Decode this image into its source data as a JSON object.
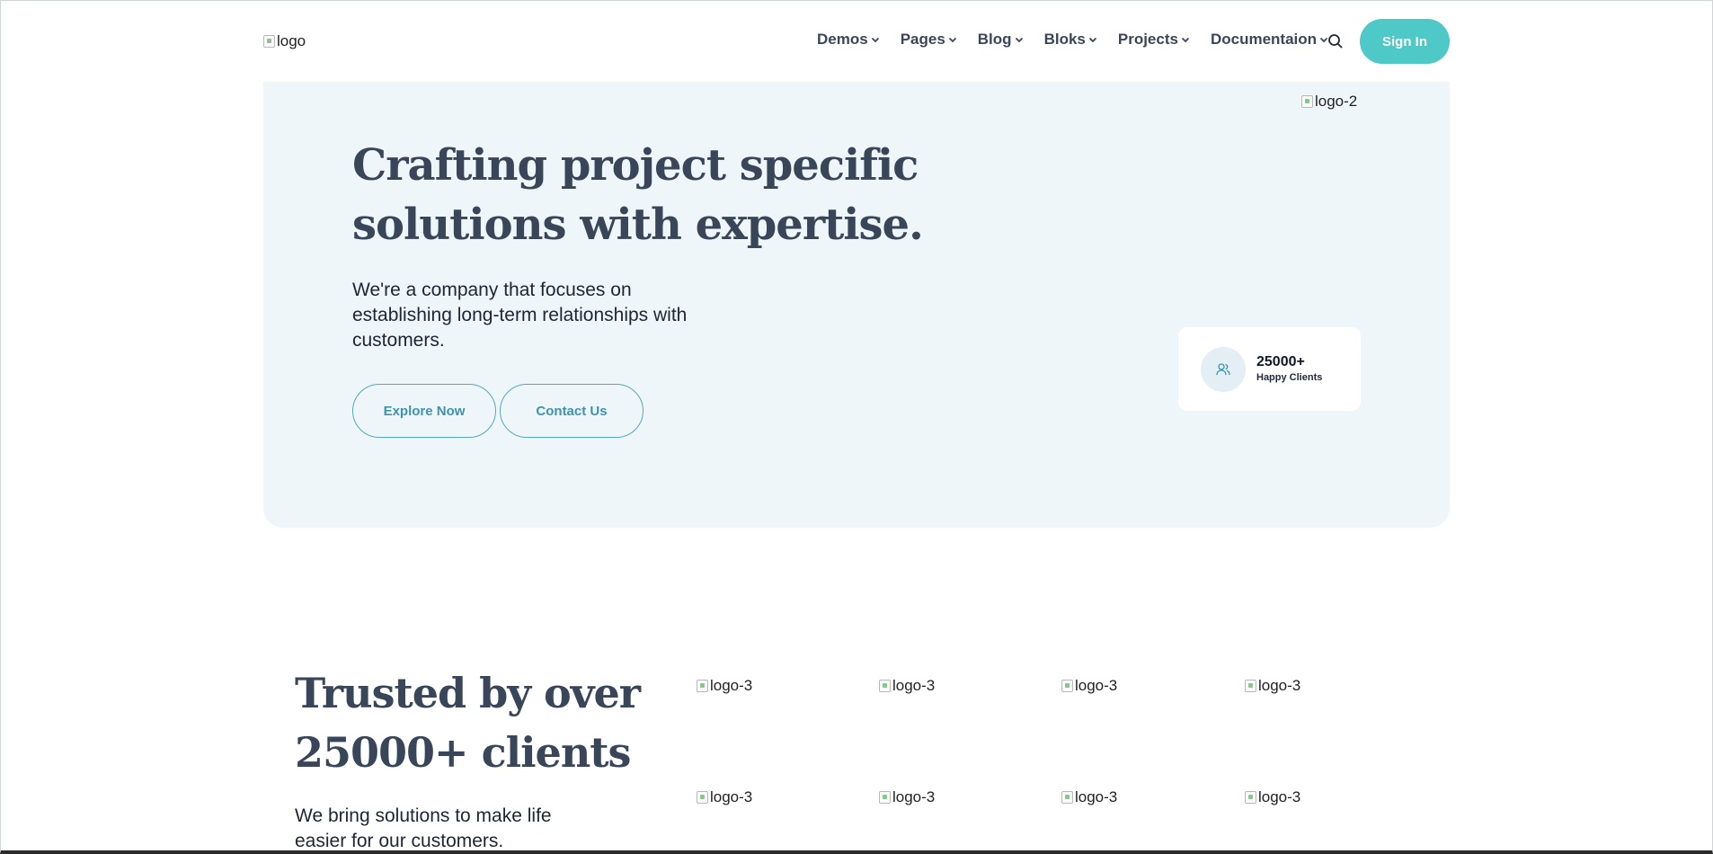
{
  "header": {
    "logo_alt": "logo",
    "nav": [
      {
        "label": "Demos"
      },
      {
        "label": "Pages"
      },
      {
        "label": "Blog"
      },
      {
        "label": "Bloks"
      },
      {
        "label": "Projects"
      },
      {
        "label": "Documentaion"
      }
    ],
    "search_icon": "search-icon",
    "signin_label": "Sign In"
  },
  "hero": {
    "logo2_alt": "logo-2",
    "title_line1": "Crafting project specific",
    "title_line2": "solutions with expertise.",
    "description": "We're a company that focuses on establishing long-term relationships with customers.",
    "explore_label": "Explore Now",
    "contact_label": "Contact Us",
    "stat": {
      "icon": "users-icon",
      "value": "25000+",
      "label": "Happy Clients"
    }
  },
  "trusted": {
    "title_line1": "Trusted by over",
    "title_line2": "25000+ clients",
    "description": "We bring solutions to make life easier for our customers.",
    "logos": [
      "logo-3",
      "logo-3",
      "logo-3",
      "logo-3",
      "logo-3",
      "logo-3",
      "logo-3",
      "logo-3"
    ]
  },
  "colors": {
    "accent": "#4ec9c7",
    "hero_bg": "#eef6f9",
    "heading": "#39465a",
    "outline_button": "#3e93ad"
  }
}
